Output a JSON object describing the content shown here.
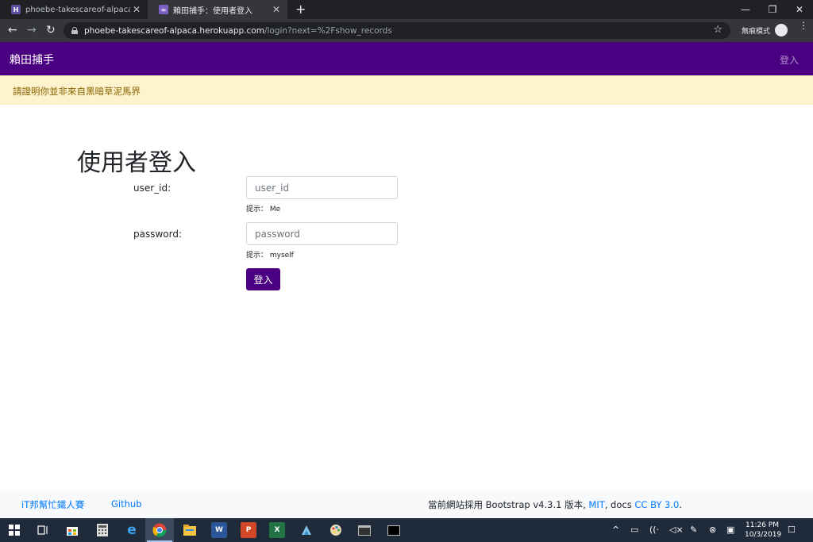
{
  "browser": {
    "tabs": [
      {
        "title": "phoebe-takescareof-alpaca · Log",
        "favicon": "H",
        "favicon_color": "#5a4f9c"
      },
      {
        "title": "賴田捕手：使用者登入",
        "favicon": "∞",
        "favicon_color": "#7b61c4"
      }
    ],
    "url_host": "phoebe-takescareof-alpaca.herokuapp.com",
    "url_path": "/login?next=%2Fshow_records",
    "incognito_label": "無痕模式"
  },
  "navbar": {
    "brand": "賴田捕手",
    "login_link": "登入",
    "color": "#4b0082"
  },
  "alert": {
    "message": "請證明你並非來自黑暗草泥馬界"
  },
  "login": {
    "title": "使用者登入",
    "user_id_label": "user_id:",
    "user_id_placeholder": "user_id",
    "user_id_hint": "提示： Me",
    "password_label": "password:",
    "password_placeholder": "password",
    "password_hint": "提示： myself",
    "submit_label": "登入"
  },
  "footer": {
    "link_ithome": "iT邦幫忙鐵人賽",
    "link_github": "Github",
    "credit_prefix": "當前網站採用 Bootstrap v4.3.1 版本, ",
    "credit_mit": "MIT",
    "credit_mid": ", docs ",
    "credit_cc": "CC BY 3.0",
    "credit_suffix": "."
  },
  "taskbar": {
    "time": "11:26 PM",
    "date": "10/3/2019",
    "apps": [
      "start",
      "task-view",
      "store",
      "calculator",
      "edge",
      "chrome",
      "file-explorer",
      "word",
      "powerpoint",
      "excel",
      "app",
      "paint",
      "terminal",
      "cmd"
    ]
  }
}
